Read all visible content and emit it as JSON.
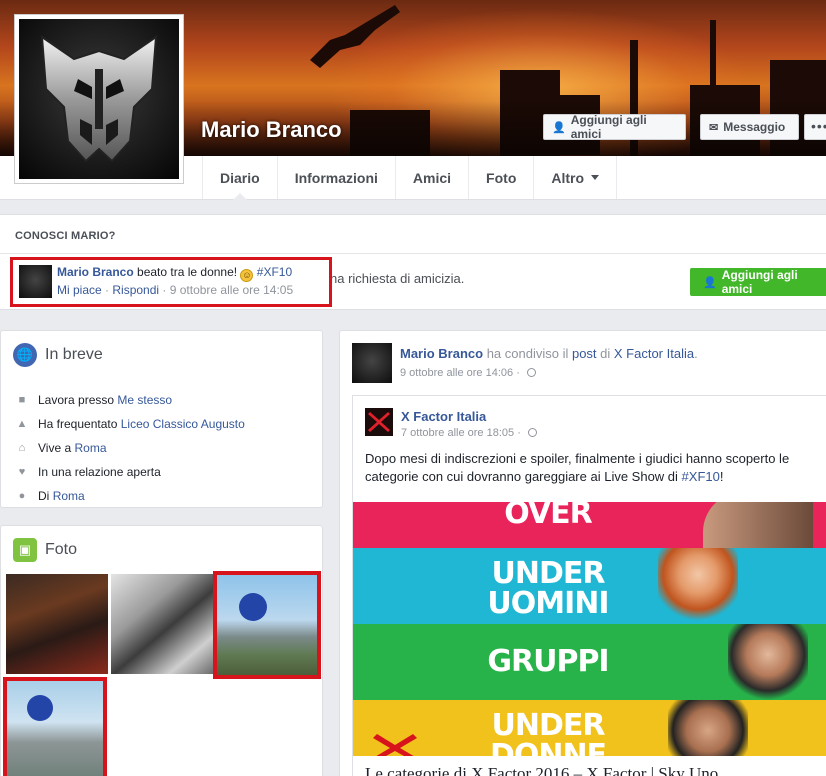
{
  "profile": {
    "name": "Mario Branco",
    "add_friend_label": "Aggiungi agli amici",
    "message_label": "Messaggio",
    "more_label": "•••"
  },
  "tabs": [
    {
      "label": "Diario"
    },
    {
      "label": "Informazioni"
    },
    {
      "label": "Amici"
    },
    {
      "label": "Foto"
    },
    {
      "label": "Altro"
    }
  ],
  "know": {
    "title": "CONOSCI MARIO?",
    "text": "na richiesta di amicizia.",
    "button_label": "Aggiungi agli amici"
  },
  "comment": {
    "author": "Mario Branco",
    "text": " beato tra le donne! ",
    "hashtag": "#XF10",
    "like": "Mi piace",
    "reply": "Rispondi",
    "time": "9 ottobre alle ore 14:05",
    "sep": " · "
  },
  "breve": {
    "title": "In breve",
    "items": [
      {
        "prefix": "Lavora presso ",
        "link": "Me stesso"
      },
      {
        "prefix": "Ha frequentato ",
        "link": "Liceo Classico Augusto"
      },
      {
        "prefix": "Vive a ",
        "link": "Roma"
      },
      {
        "prefix": "In una relazione aperta",
        "link": ""
      },
      {
        "prefix": "Di ",
        "link": "Roma"
      }
    ]
  },
  "foto": {
    "title": "Foto"
  },
  "post": {
    "author": "Mario Branco",
    "shared_text": " ha condiviso il ",
    "post_word": "post",
    "of_text": " di ",
    "page": "X Factor Italia",
    "end": ".",
    "time": "9 ottobre alle ore 14:06 · ",
    "shared": {
      "name": "X Factor Italia",
      "time": "7 ottobre alle ore 18:05 · ",
      "text": "Dopo mesi di indiscrezioni e spoiler, finalmente i giudici hanno scoperto le categorie con cui dovranno gareggiare ai Live Show di ",
      "hashtag": "#XF10",
      "text_end": "!",
      "bands": [
        {
          "label": "OVER",
          "color": "#e8245a"
        },
        {
          "label": "UNDER",
          "label2": "UOMINI",
          "color": "#1fb7d4"
        },
        {
          "label": "GRUPPI",
          "color": "#27b34a"
        },
        {
          "label": "UNDER",
          "label2": "DONNE",
          "color": "#f2c21c"
        }
      ],
      "link_title": "Le categorie di X Factor 2016 – X Factor | Sky Uno"
    }
  },
  "colors": {
    "link": "#365899",
    "highlight": "#d7141c",
    "green": "#42b72a"
  }
}
